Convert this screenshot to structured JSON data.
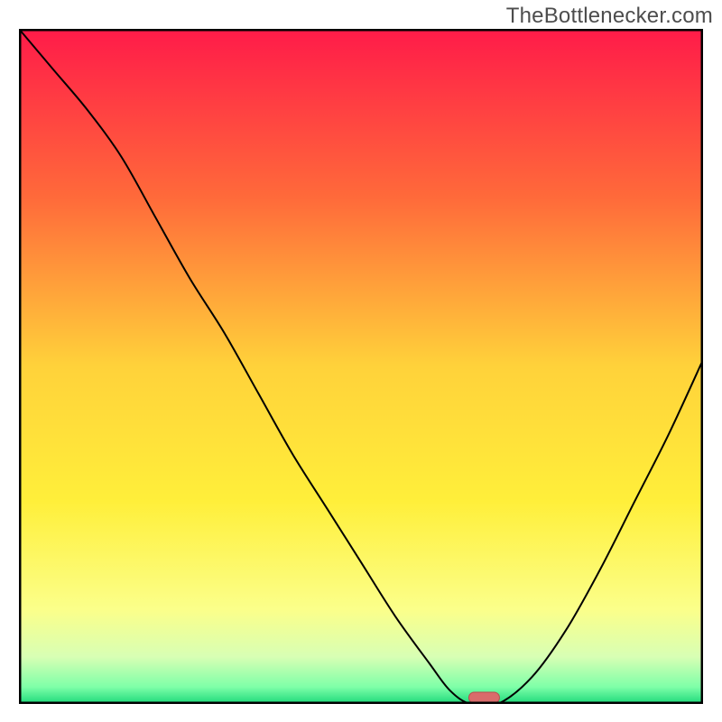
{
  "watermark": "TheBottlenecker.com",
  "colors": {
    "curve": "#000000",
    "marker_fill": "#d96b6b",
    "marker_stroke": "#b84f4f",
    "border": "#000000"
  },
  "chart_data": {
    "type": "line",
    "title": "",
    "xlabel": "",
    "ylabel": "",
    "xlim": [
      0,
      100
    ],
    "ylim": [
      0,
      100
    ],
    "x": [
      0,
      5,
      10,
      15,
      20,
      25,
      30,
      35,
      40,
      45,
      50,
      55,
      60,
      63,
      66,
      70,
      75,
      80,
      85,
      90,
      95,
      100
    ],
    "values": [
      100,
      94,
      88,
      81,
      72,
      63,
      55,
      46,
      37,
      29,
      21,
      13,
      6,
      2,
      0,
      0,
      4,
      11,
      20,
      30,
      40,
      51
    ],
    "optimum_x": 68,
    "gradient_stops": [
      {
        "pos": 0.0,
        "color": "#ff1b49"
      },
      {
        "pos": 0.25,
        "color": "#ff6a3a"
      },
      {
        "pos": 0.5,
        "color": "#ffd23a"
      },
      {
        "pos": 0.7,
        "color": "#ffef3a"
      },
      {
        "pos": 0.86,
        "color": "#fbff8a"
      },
      {
        "pos": 0.93,
        "color": "#d8ffb4"
      },
      {
        "pos": 0.975,
        "color": "#7effa8"
      },
      {
        "pos": 1.0,
        "color": "#1cd97a"
      }
    ]
  }
}
